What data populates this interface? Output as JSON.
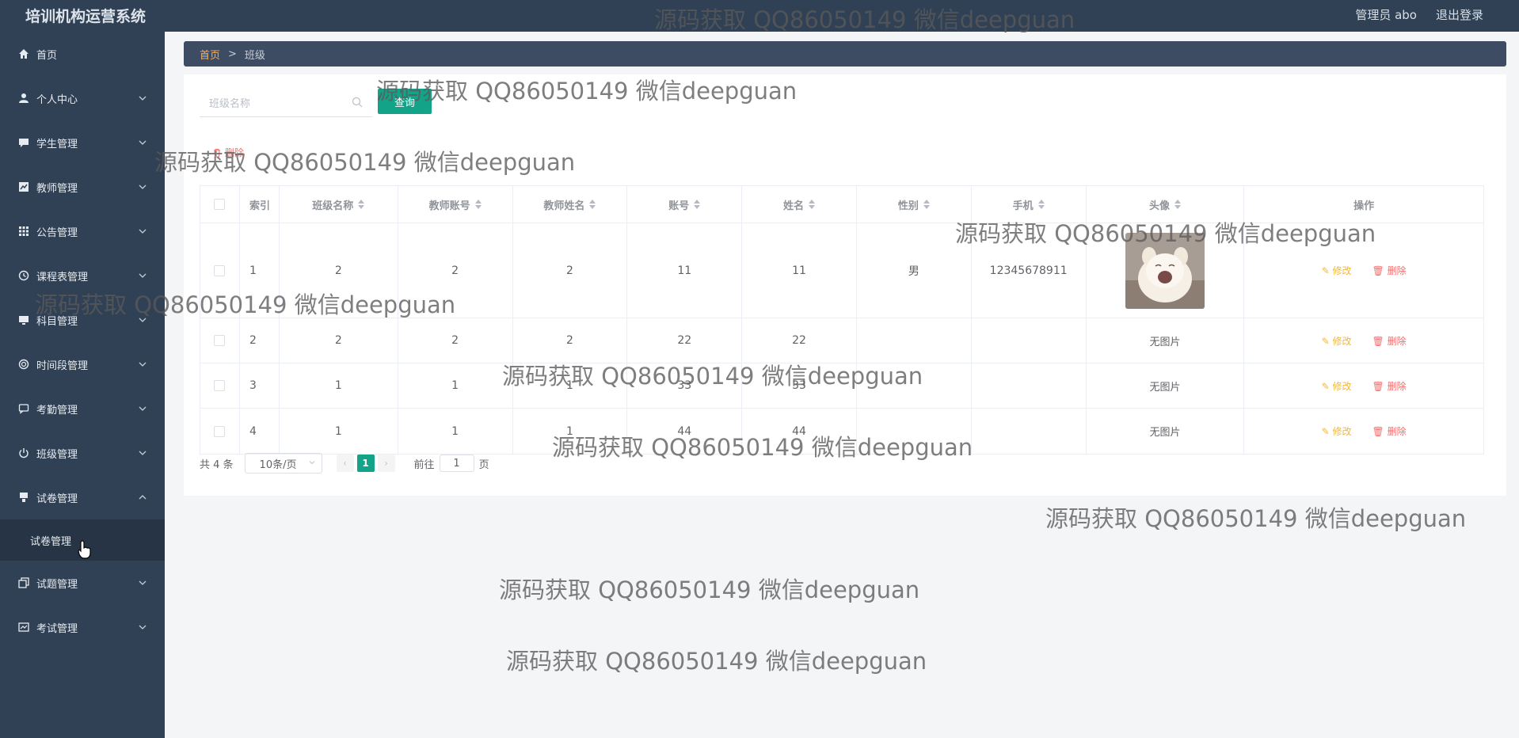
{
  "header": {
    "app_title": "培训机构运营系统",
    "user_label": "管理员 abo",
    "logout_label": "退出登录"
  },
  "sidebar": {
    "items": [
      {
        "label": "首页",
        "icon": "home-icon"
      },
      {
        "label": "个人中心",
        "icon": "user-icon"
      },
      {
        "label": "学生管理",
        "icon": "chat-icon"
      },
      {
        "label": "教师管理",
        "icon": "chart-icon"
      },
      {
        "label": "公告管理",
        "icon": "grid-icon"
      },
      {
        "label": "课程表管理",
        "icon": "clock-icon"
      },
      {
        "label": "科目管理",
        "icon": "monitor-icon"
      },
      {
        "label": "时间段管理",
        "icon": "circle-icon"
      },
      {
        "label": "考勤管理",
        "icon": "message-icon"
      },
      {
        "label": "班级管理",
        "icon": "power-icon"
      },
      {
        "label": "试卷管理",
        "icon": "paper-icon",
        "expanded": true,
        "subitem": "试卷管理"
      },
      {
        "label": "试题管理",
        "icon": "copy-icon"
      },
      {
        "label": "考试管理",
        "icon": "exam-icon"
      }
    ]
  },
  "breadcrumb": {
    "home": "首页",
    "sep": ">",
    "current": "班级"
  },
  "search": {
    "placeholder": "班级名称",
    "query_label": "查询",
    "batch_delete_label": "删除"
  },
  "table": {
    "headers": [
      "索引",
      "班级名称",
      "教师账号",
      "教师姓名",
      "账号",
      "姓名",
      "性别",
      "手机",
      "头像",
      "操作"
    ],
    "edit_label": "修改",
    "delete_label": "删除",
    "no_image": "无图片",
    "rows": [
      {
        "index": "1",
        "class_name": "2",
        "teacher_account": "2",
        "teacher_name": "2",
        "account": "11",
        "name": "11",
        "gender": "男",
        "phone": "12345678911",
        "has_avatar": true
      },
      {
        "index": "2",
        "class_name": "2",
        "teacher_account": "2",
        "teacher_name": "2",
        "account": "22",
        "name": "22",
        "gender": "",
        "phone": "",
        "has_avatar": false
      },
      {
        "index": "3",
        "class_name": "1",
        "teacher_account": "1",
        "teacher_name": "1",
        "account": "33",
        "name": "33",
        "gender": "",
        "phone": "",
        "has_avatar": false
      },
      {
        "index": "4",
        "class_name": "1",
        "teacher_account": "1",
        "teacher_name": "1",
        "account": "44",
        "name": "44",
        "gender": "",
        "phone": "",
        "has_avatar": false
      }
    ]
  },
  "pagination": {
    "total": "共 4 条",
    "page_size": "10条/页",
    "current_page": "1",
    "goto_prefix": "前往",
    "goto_value": "1",
    "goto_suffix": "页"
  },
  "watermark": "源码获取 QQ86050149 微信deepguan",
  "colors": {
    "sidebar_bg": "#304156",
    "accent": "#13a389",
    "danger": "#f56c6c",
    "warning": "#f3b73c"
  }
}
